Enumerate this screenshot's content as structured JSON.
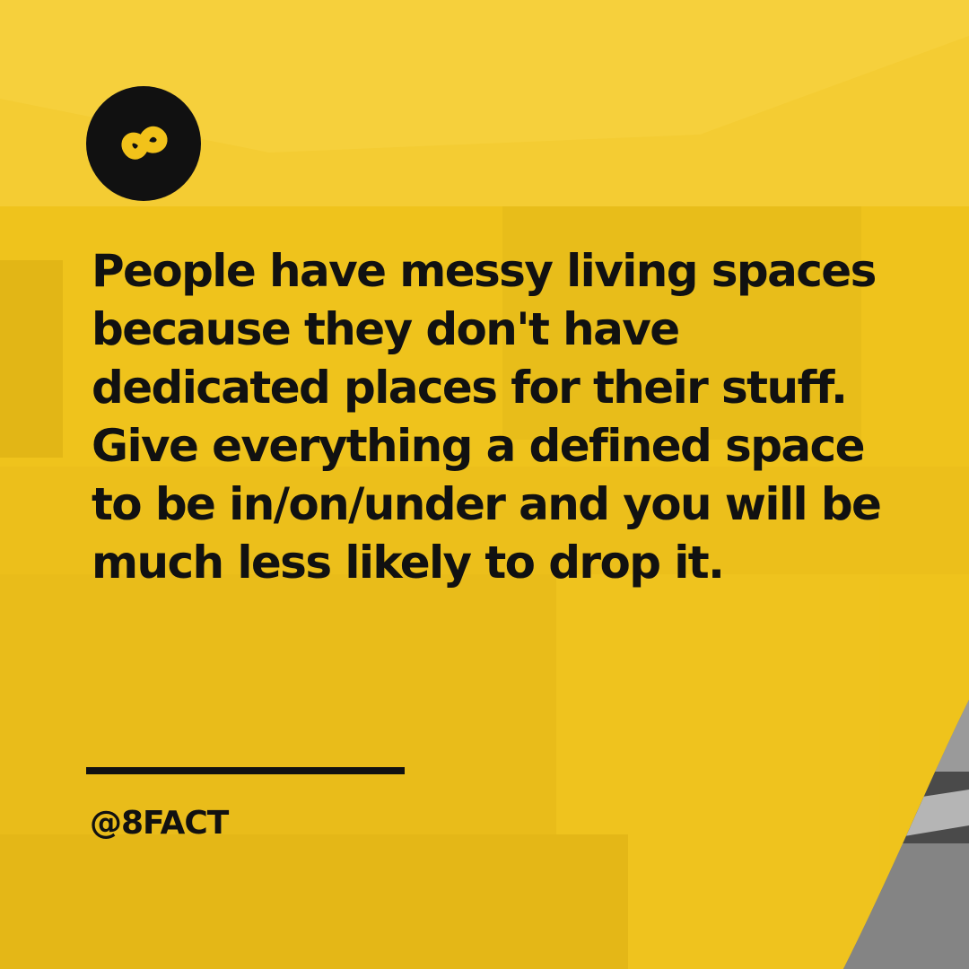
{
  "colors": {
    "background": "#efc31c",
    "text": "#111111",
    "accent": "#f2c21a"
  },
  "logo": {
    "icon": "infinity-8-icon"
  },
  "post": {
    "quote": "People have messy living spaces because they don't have dedicated places for their stuff. Give everything a defined space to be in/on/under and you will be much less likely to drop it.",
    "handle": "@8FACT"
  }
}
